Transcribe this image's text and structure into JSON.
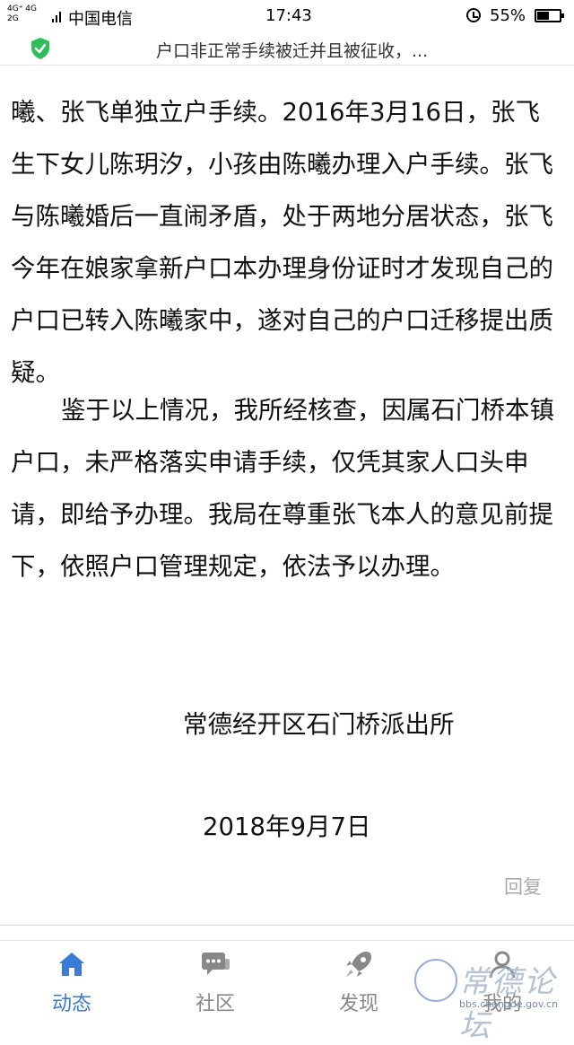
{
  "status_bar": {
    "network_top": "4G⁺ 4G",
    "network_bottom": "2G",
    "carrier": "中国电信",
    "time": "17:43",
    "battery": "55%",
    "battery_level": 0.55
  },
  "url_bar": {
    "title": "户口非正常手续被迁并且被征收，..."
  },
  "article": {
    "paragraph1": "曦、张飞单独立户手续。2016年3月16日，张飞生下女儿陈玥汐，小孩由陈曦办理入户手续。张飞与陈曦婚后一直闹矛盾，处于两地分居状态，张飞今年在娘家拿新户口本办理身份证时才发现自己的户口已转入陈曦家中，遂对自己的户口迁移提出质疑。",
    "paragraph2": "鉴于以上情况，我所经核查，因属石门桥本镇户口，未严格落实申请手续，仅凭其家人口头申请，即给予办理。我局在尊重张飞本人的意见前提下，依照户口管理规定，依法予以办理。",
    "signature": "常德经开区石门桥派出所",
    "date": "2018年9月7日",
    "reply_label": "回复"
  },
  "tab_bar": {
    "tabs": [
      {
        "label": "动态",
        "icon": "home-icon",
        "active": true
      },
      {
        "label": "社区",
        "icon": "chat-icon",
        "active": false
      },
      {
        "label": "发现",
        "icon": "rocket-icon",
        "active": false
      },
      {
        "label": "我的",
        "icon": "user-icon",
        "active": false
      }
    ]
  },
  "watermark": {
    "text": "常德论坛",
    "url": "bbs.changde.gov.cn"
  },
  "colors": {
    "accent": "#3a7bd5",
    "shield": "#2ebd59",
    "tab_inactive": "#888888"
  }
}
